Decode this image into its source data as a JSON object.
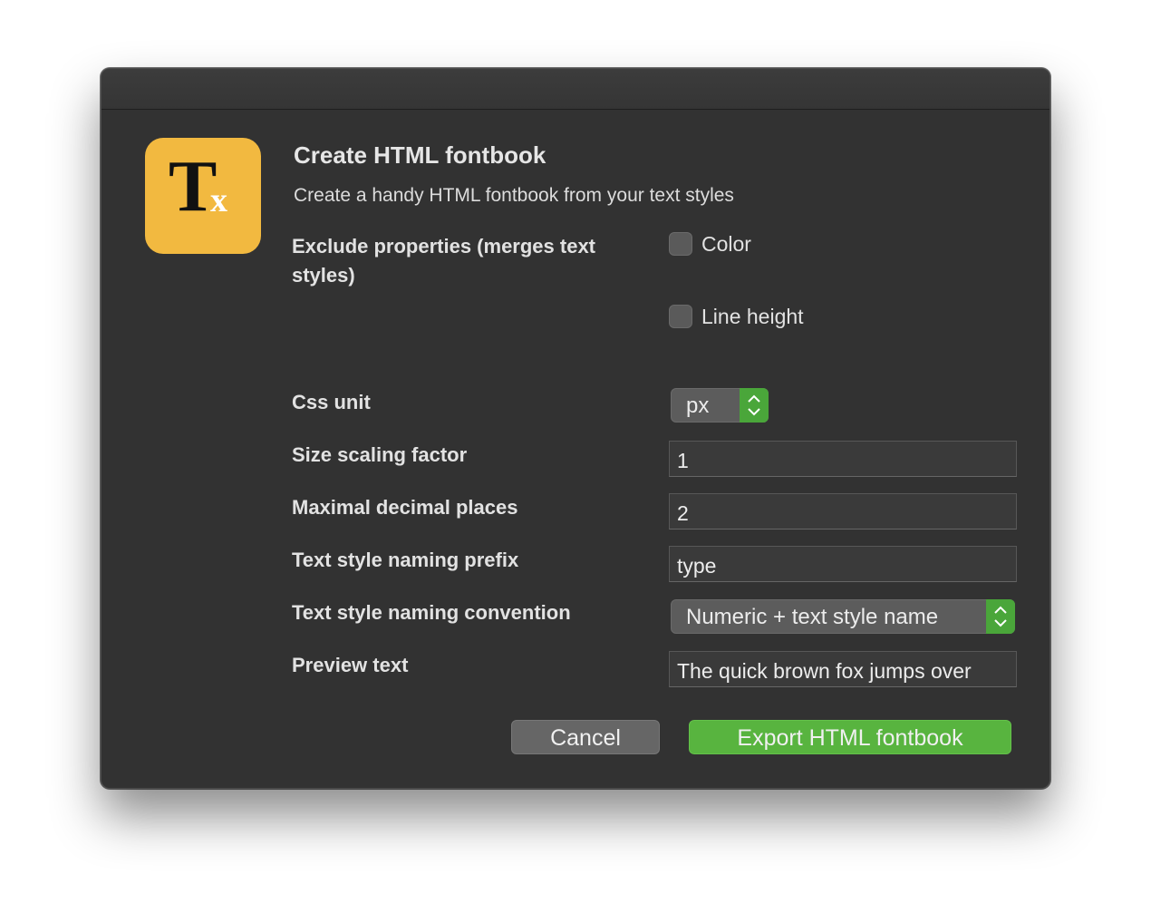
{
  "dialog": {
    "title": "Create HTML fontbook",
    "subtitle": "Create a handy HTML fontbook from your text styles",
    "icon": {
      "glyph_main": "T",
      "glyph_sub": "x",
      "color": "#f2b940"
    }
  },
  "exclude": {
    "label": "Exclude properties (merges text styles)",
    "options": [
      {
        "label": "Color",
        "checked": false
      },
      {
        "label": "Line height",
        "checked": false
      }
    ]
  },
  "css_unit": {
    "label": "Css unit",
    "value": "px"
  },
  "size_scaling": {
    "label": "Size scaling factor",
    "value": "1"
  },
  "decimal_places": {
    "label": "Maximal decimal places",
    "value": "2"
  },
  "naming_prefix": {
    "label": "Text style naming prefix",
    "value": "type"
  },
  "naming_convention": {
    "label": "Text style naming convention",
    "value": "Numeric + text style name"
  },
  "preview_text": {
    "label": "Preview text",
    "value": "The quick brown fox jumps over"
  },
  "buttons": {
    "cancel": "Cancel",
    "export": "Export HTML fontbook"
  },
  "colors": {
    "window_bg": "#323232",
    "accent_green": "#58b43f",
    "icon_yellow": "#f2b940"
  }
}
